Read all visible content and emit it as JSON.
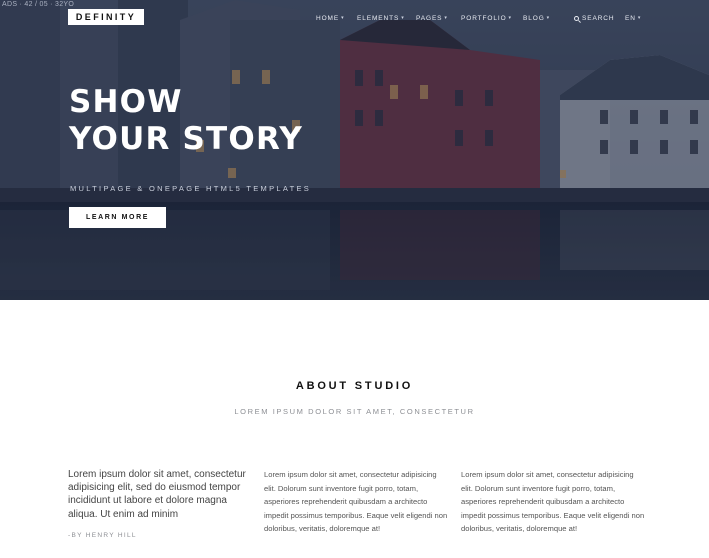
{
  "hero": {
    "tag": "ADS · 42 / 05 · 32YO",
    "title_line1": "SHOW",
    "title_line2": "YOUR STORY",
    "subtitle": "MULTIPAGE & ONEPAGE HTML5 TEMPLATES",
    "cta_label": "LEARN MORE"
  },
  "header": {
    "logo": "DEFINITY",
    "nav": {
      "home": "HOME",
      "elements": "ELEMENTS",
      "pages": "PAGES",
      "portfolio": "PORTFOLIO",
      "blog": "BLOG",
      "search": "SEARCH",
      "lang": "EN"
    },
    "caret": "▾",
    "icons": {
      "search": "search-icon",
      "caret": "chevron-down-icon"
    }
  },
  "about": {
    "title": "ABOUT STUDIO",
    "subtitle": "LOREM IPSUM DOLOR SIT AMET, CONSECTETUR",
    "quote": "Lorem ipsum dolor sit amet, consectetur adipisicing elit, sed do eiusmod tempor incididunt ut labore et dolore magna aliqua. Ut enim ad minim",
    "author": "-BY HENRY HILL",
    "column_2": "Lorem ipsum dolor sit amet, consectetur adipisicing elit. Dolorum sunt inventore fugit porro, totam, asperiores reprehenderit quibusdam a architecto impedit possimus temporibus. Eaque velit eligendi non doloribus, veritatis, doloremque at!",
    "column_3": "Lorem ipsum dolor sit amet, consectetur adipisicing elit. Dolorum sunt inventore fugit porro, totam, asperiores reprehenderit quibusdam a architecto impedit possimus temporibus. Eaque velit eligendi non doloribus, veritatis, doloremque at!"
  },
  "colors": {
    "hero_overlay": "#2c3650",
    "accent_building": "#6b3346",
    "text_dark": "#111111",
    "text_muted": "#8d8f94"
  }
}
